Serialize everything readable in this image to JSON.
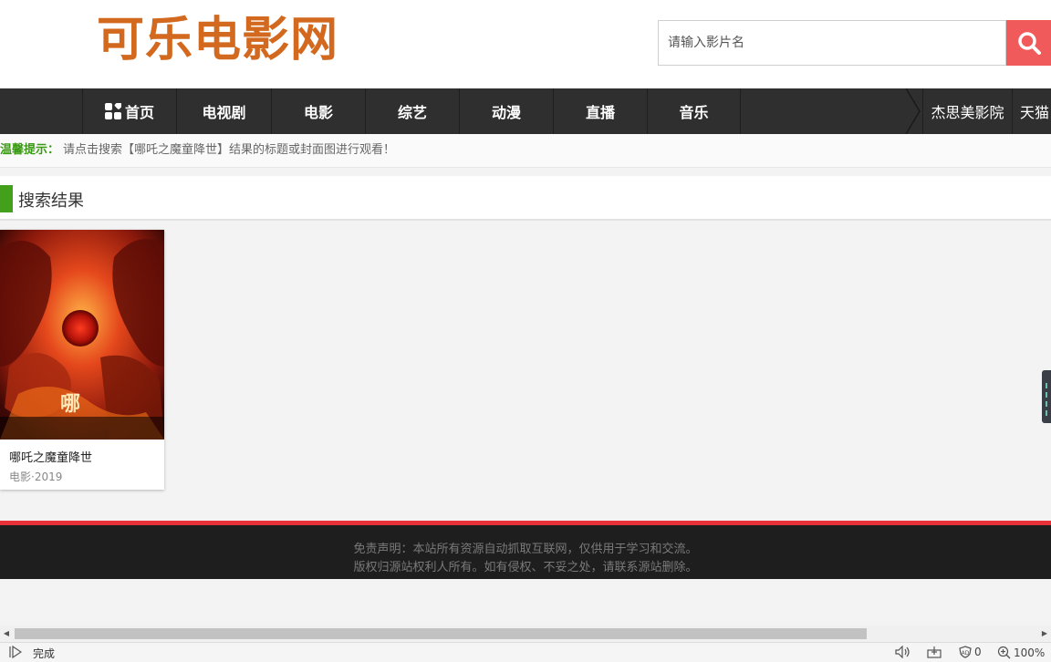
{
  "header": {
    "logo_text": "可乐电影网",
    "search_placeholder": "请输入影片名"
  },
  "nav": {
    "items": [
      {
        "label": "首页",
        "icon": "grid-icon"
      },
      {
        "label": "电视剧"
      },
      {
        "label": "电影"
      },
      {
        "label": "综艺"
      },
      {
        "label": "动漫"
      },
      {
        "label": "直播"
      },
      {
        "label": "音乐"
      }
    ],
    "extra": [
      {
        "label": "杰思美影院"
      },
      {
        "label": "天猫"
      }
    ]
  },
  "tip": {
    "label": "温馨提示：",
    "text": "请点击搜索【哪吒之魔童降世】结果的标题或封面图进行观看！"
  },
  "results": {
    "title": "搜索结果",
    "items": [
      {
        "title": "哪吒之魔童降世",
        "meta": "电影·2019"
      }
    ]
  },
  "footer": {
    "line1": "免责声明：本站所有资源自动抓取互联网，仅供用于学习和交流。",
    "line2": "版权归源站权利人所有。如有侵权、不妥之处，请联系源站删除。"
  },
  "statusbar": {
    "status": "完成",
    "shield_count": "0",
    "zoom": "100%"
  },
  "colors": {
    "brand": "#d2691e",
    "nav_bg": "#2f2f2f",
    "accent_green": "#43a01b",
    "search_btn": "#f15a5a",
    "footer_stripe": "#e8323a"
  }
}
